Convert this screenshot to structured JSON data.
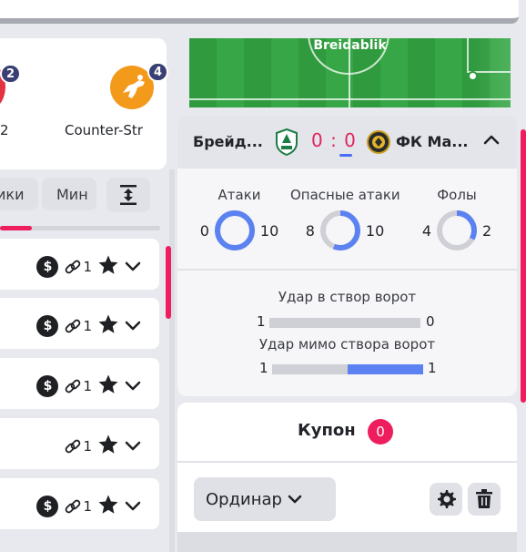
{
  "colors": {
    "accent": "#ee1d5e",
    "score": "#e0245e",
    "donut": "#5b82f0",
    "donut_track": "#cfd0d5"
  },
  "games": [
    {
      "label": "2",
      "badge": "2",
      "icon": "game-icon"
    },
    {
      "label": "Counter-Str",
      "badge": "4",
      "icon": "counter-strike-icon"
    }
  ],
  "filters": {
    "chip_a": "ики",
    "chip_b": "Мин"
  },
  "left_progress": 0.2,
  "event_rows": [
    {
      "has_dollar": true,
      "link_count": "1"
    },
    {
      "has_dollar": true,
      "link_count": "1"
    },
    {
      "has_dollar": true,
      "link_count": "1"
    },
    {
      "has_dollar": false,
      "link_count": "1"
    },
    {
      "has_dollar": true,
      "link_count": "1"
    }
  ],
  "field": {
    "team_name": "Breidablik"
  },
  "match": {
    "team1": "Брейд...",
    "team2": "ФК Ма...",
    "score": "0 : 0"
  },
  "stats": [
    {
      "title": "Атаки",
      "home": "0",
      "away": "10",
      "home_share": 0.0
    },
    {
      "title": "Опасные атаки",
      "home": "8",
      "away": "10",
      "home_share": 0.44
    },
    {
      "title": "Фолы",
      "home": "4",
      "away": "2",
      "home_share": 0.67
    }
  ],
  "shots": [
    {
      "title": "Удар в створ ворот",
      "home": "1",
      "away": "0",
      "home_share": 1.0
    },
    {
      "title": "Удар мимо створа ворот",
      "home": "1",
      "away": "1",
      "home_share": 0.5
    }
  ],
  "coupon": {
    "title": "Купон",
    "count": "0",
    "bet_type": "Ординар"
  }
}
